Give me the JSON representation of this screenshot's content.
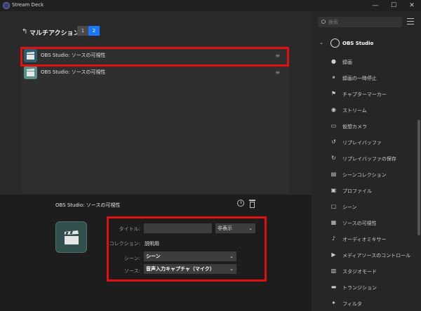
{
  "app": {
    "title": "Stream Deck"
  },
  "window_controls": {
    "minimize": "—",
    "maximize": "☐",
    "close": "✕"
  },
  "header": {
    "title": "マルチアクション",
    "pages": [
      "1",
      "2"
    ]
  },
  "actions": [
    {
      "label": "OBS Studio: ソースの可視性"
    },
    {
      "label": "OBS Studio: ソースの可視性"
    }
  ],
  "inspector": {
    "title": "OBS Studio:   ソースの可視性",
    "fields": {
      "title_label": "タイトル:",
      "title_value": "",
      "visibility_value": "非表示",
      "collection_label": "コレクション:",
      "collection_value": "説明用",
      "scene_label": "シーン:",
      "scene_value": "シーン",
      "source_label": "ソース:",
      "source_value": "音声入力キャプチャ（マイク）"
    }
  },
  "sidebar": {
    "search_placeholder": "検索",
    "category": "OBS Studio",
    "items": [
      {
        "label": "録画",
        "icon": "●"
      },
      {
        "label": "録画の一時停止",
        "icon": "⏸"
      },
      {
        "label": "チャプターマーカー",
        "icon": "⚑"
      },
      {
        "label": "ストリーム",
        "icon": "◉"
      },
      {
        "label": "仮想カメラ",
        "icon": "▭"
      },
      {
        "label": "リプレイバッファ",
        "icon": "↺"
      },
      {
        "label": "リプレイバッファの保存",
        "icon": "↻"
      },
      {
        "label": "シーンコレクション",
        "icon": "▤"
      },
      {
        "label": "プロファイル",
        "icon": "▣"
      },
      {
        "label": "シーン",
        "icon": "▢"
      },
      {
        "label": "ソースの可視性",
        "icon": "▦"
      },
      {
        "label": "オーディオミキサー",
        "icon": "♪"
      },
      {
        "label": "メディアソースのコントロール",
        "icon": "▶"
      },
      {
        "label": "スタジオモード",
        "icon": "▥"
      },
      {
        "label": "トランジション",
        "icon": "▬"
      },
      {
        "label": "フィルタ",
        "icon": "✦"
      }
    ]
  },
  "colors": {
    "accent": "#1978ff",
    "highlight": "#e01010"
  }
}
